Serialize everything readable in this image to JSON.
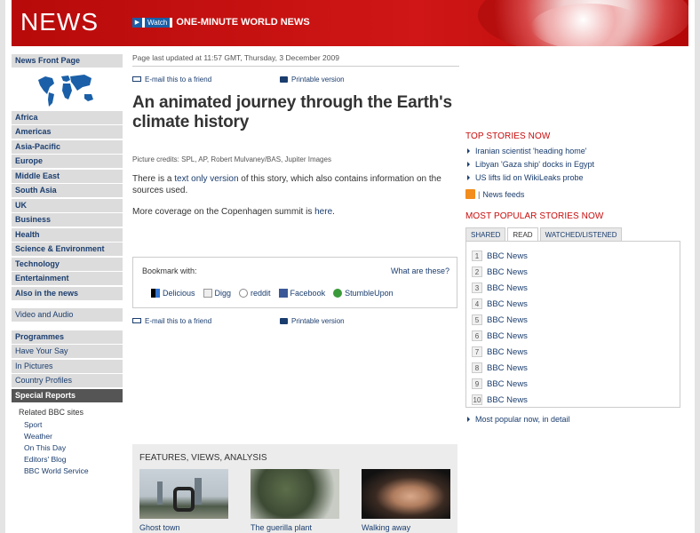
{
  "banner": {
    "logo": "NEWS",
    "watch_label": "Watch",
    "watch_title": "ONE-MINUTE WORLD NEWS"
  },
  "sidebar": {
    "front_page": "News Front Page",
    "regions": [
      "Africa",
      "Americas",
      "Asia-Pacific",
      "Europe",
      "Middle East",
      "South Asia",
      "UK",
      "Business",
      "Health",
      "Science & Environment",
      "Technology",
      "Entertainment",
      "Also in the news"
    ],
    "video_audio": "Video and Audio",
    "section2": [
      "Programmes",
      "Have Your Say",
      "In Pictures",
      "Country Profiles"
    ],
    "special_reports": "Special Reports",
    "related_header": "Related BBC sites",
    "related_links": [
      "Sport",
      "Weather",
      "On This Day",
      "Editors' Blog",
      "BBC World Service"
    ]
  },
  "article": {
    "updated": "Page last updated at 11:57 GMT, Thursday, 3 December 2009",
    "email_label": "E-mail this to a friend",
    "print_label": "Printable version",
    "title": "An animated journey through the Earth's climate history",
    "credits": "Picture credits: SPL, AP, Robert Mulvaney/BAS, Jupiter Images",
    "para1_pre": "There is a ",
    "para1_link": "text only version",
    "para1_post": " of this story, which also contains information on the sources used.",
    "para2_pre": "More coverage on the Copenhagen summit is ",
    "para2_link": "here",
    "para2_post": "."
  },
  "bookmark": {
    "label": "Bookmark with:",
    "what": "What are these?",
    "services": [
      "Delicious",
      "Digg",
      "reddit",
      "Facebook",
      "StumbleUpon"
    ]
  },
  "features": {
    "header": "FEATURES, VIEWS, ANALYSIS",
    "items": [
      "Ghost town",
      "The guerilla plant",
      "Walking away"
    ]
  },
  "top_stories": {
    "header": "TOP STORIES NOW",
    "items": [
      "Iranian scientist 'heading home'",
      "Libyan 'Gaza ship' docks in Egypt",
      "US lifts lid on WikiLeaks probe"
    ],
    "feeds_label": "News feeds"
  },
  "popular": {
    "header": "MOST POPULAR STORIES NOW",
    "tabs": [
      "SHARED",
      "READ",
      "WATCHED/LISTENED"
    ],
    "active_tab": "READ",
    "items": [
      "BBC News",
      "BBC News",
      "BBC News",
      "BBC News",
      "BBC News",
      "BBC News",
      "BBC News",
      "BBC News",
      "BBC News",
      "BBC News"
    ],
    "more": "Most popular now, in detail"
  },
  "colors": {
    "brand_red": "#c70c0c",
    "link_blue": "#1a3d6e"
  }
}
